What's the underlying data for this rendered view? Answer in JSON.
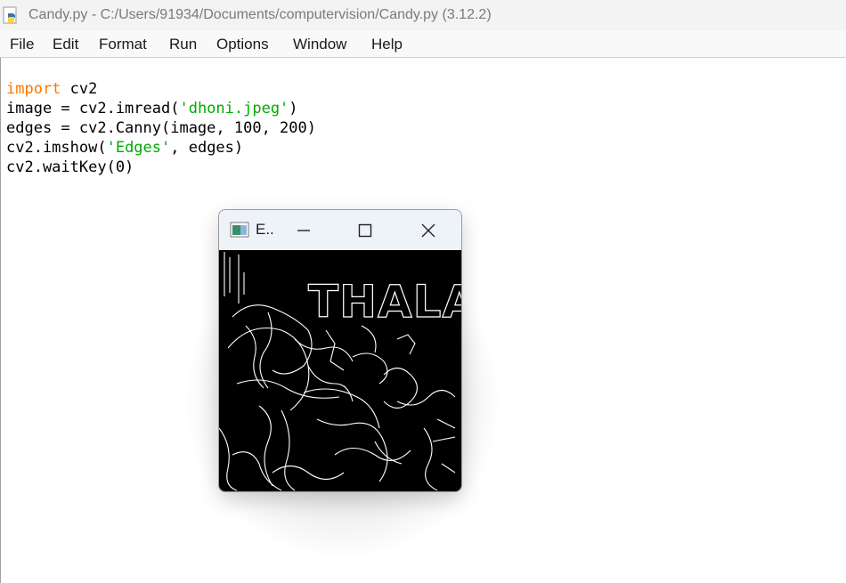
{
  "window": {
    "title": "Candy.py - C:/Users/91934/Documents/computervision/Candy.py (3.12.2)"
  },
  "menu": [
    "File",
    "Edit",
    "Format",
    "Run",
    "Options",
    "Window",
    "Help"
  ],
  "code": {
    "line1": {
      "kw": "import",
      "rest": " cv2"
    },
    "line2": {
      "pre": "image = cv2.imread(",
      "str": "'dhoni.jpeg'",
      "post": ")"
    },
    "line3": {
      "text": "edges = cv2.Canny(image, 100, 200)"
    },
    "line4": {
      "pre": "cv2.imshow(",
      "str": "'Edges'",
      "post": ", edges)"
    },
    "line5": {
      "text": "cv2.waitKey(0)"
    }
  },
  "cv_window": {
    "title": "E..",
    "image_text": "THALA"
  },
  "colors": {
    "keyword": "#ff7700",
    "string": "#00aa00",
    "edge": "#ffffff",
    "edge_bg": "#000000"
  },
  "icons": [
    "python-file-icon",
    "opencv-window-icon",
    "minimize-icon",
    "maximize-icon",
    "close-icon"
  ]
}
